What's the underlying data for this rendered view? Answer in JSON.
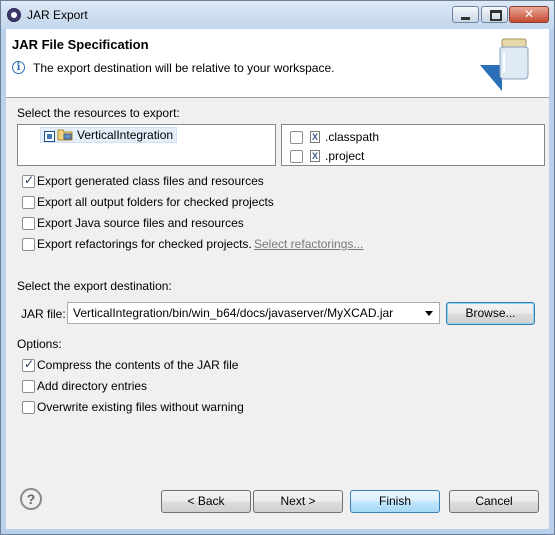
{
  "window": {
    "title": "JAR Export",
    "title_icon": "eclipse-icon"
  },
  "header": {
    "title": "JAR File Specification",
    "message": "The export destination will be relative to your workspace.",
    "info_icon": "info-icon",
    "banner_icon": "jar-icon"
  },
  "resources": {
    "label": "Select the resources to export:",
    "tree": [
      {
        "label": "VerticalIntegration",
        "state": "partial"
      }
    ],
    "files": [
      {
        "label": ".classpath",
        "checked": false
      },
      {
        "label": ".project",
        "checked": false
      }
    ]
  },
  "options_top": [
    {
      "label": "Export generated class files and resources",
      "checked": true
    },
    {
      "label": "Export all output folders for checked projects",
      "checked": false
    },
    {
      "label": "Export Java source files and resources",
      "checked": false
    },
    {
      "label": "Export refactorings for checked projects.",
      "checked": false
    }
  ],
  "select_refactorings_link": "Select refactorings...",
  "destination": {
    "label": "Select the export destination:",
    "jar_file_label": "JAR file:",
    "jar_file_value": "VerticalIntegration/bin/win_b64/docs/javaserver/MyXCAD.jar",
    "browse_label": "Browse..."
  },
  "options": {
    "label": "Options:",
    "items": [
      {
        "label": "Compress the contents of the JAR file",
        "checked": true
      },
      {
        "label": "Add directory entries",
        "checked": false
      },
      {
        "label": "Overwrite existing files without warning",
        "checked": false
      }
    ]
  },
  "buttons": {
    "back": "< Back",
    "next": "Next >",
    "finish": "Finish",
    "cancel": "Cancel"
  }
}
